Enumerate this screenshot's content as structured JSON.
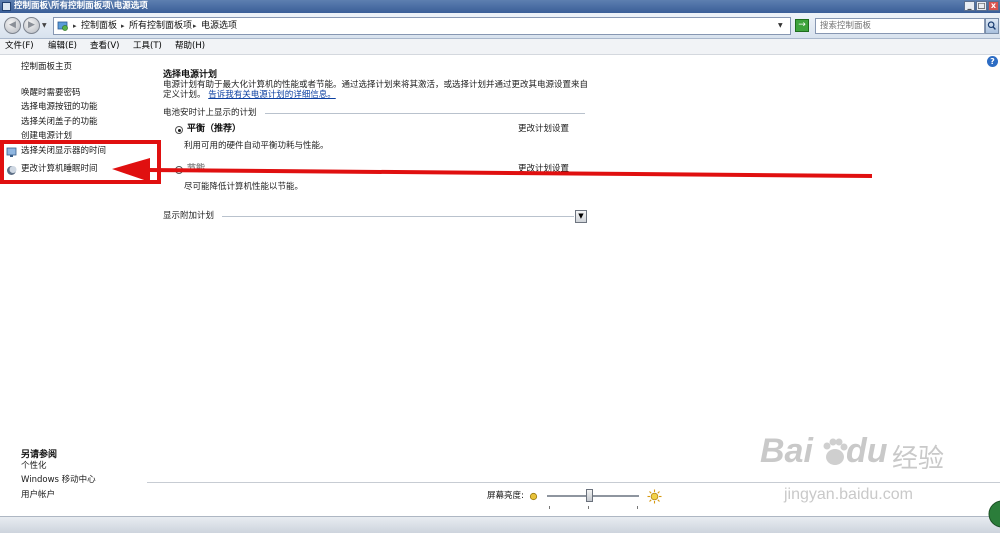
{
  "window": {
    "title": "控制面板\\所有控制面板项\\电源选项",
    "min_label": "_",
    "max_label": "□",
    "close_label": "x"
  },
  "address": {
    "crumbs": [
      "控制面板",
      "所有控制面板项",
      "电源选项"
    ],
    "search_placeholder": "搜索控制面板",
    "back_label": "◀",
    "forward_label": "▶",
    "go_label": "→"
  },
  "menu": [
    "文件(F)",
    "编辑(E)",
    "查看(V)",
    "工具(T)",
    "帮助(H)"
  ],
  "sidebar": {
    "home": "控制面板主页",
    "items": [
      "唤醒时需要密码",
      "选择电源按钮的功能",
      "选择关闭盖子的功能",
      "创建电源计划",
      "选择关闭显示器的时间",
      "更改计算机睡眠时间"
    ],
    "see_also_title": "另请参阅",
    "see_also": [
      "个性化",
      "Windows 移动中心",
      "用户帐户"
    ]
  },
  "main": {
    "title": "选择电源计划",
    "description": "电源计划有助于最大化计算机的性能或者节能。通过选择计划来将其激活，或选择计划并通过更改其电源设置来自定义计划。",
    "description_link": "告诉我有关电源计划的详细信息。",
    "battery_group_label": "电池安时计上显示的计划",
    "plans": [
      {
        "name": "平衡（推荐）",
        "desc": "利用可用的硬件自动平衡功耗与性能。",
        "link": "更改计划设置",
        "selected": true
      },
      {
        "name": "节能",
        "desc": "尽可能降低计算机性能以节能。",
        "link": "更改计划设置",
        "selected": false
      }
    ],
    "extra_plans_label": "显示附加计划",
    "help_label": "?"
  },
  "brightness": {
    "label": "屏幕亮度:",
    "level_fraction": 0.43
  },
  "watermark": {
    "brand": "Bai",
    "brand2": "du",
    "cn": "经验",
    "url": "jingyan.baidu.com"
  },
  "colors": {
    "highlight_red": "#e01010",
    "link_blue": "#0b3fa0",
    "title_bar": "#3a5e98"
  }
}
